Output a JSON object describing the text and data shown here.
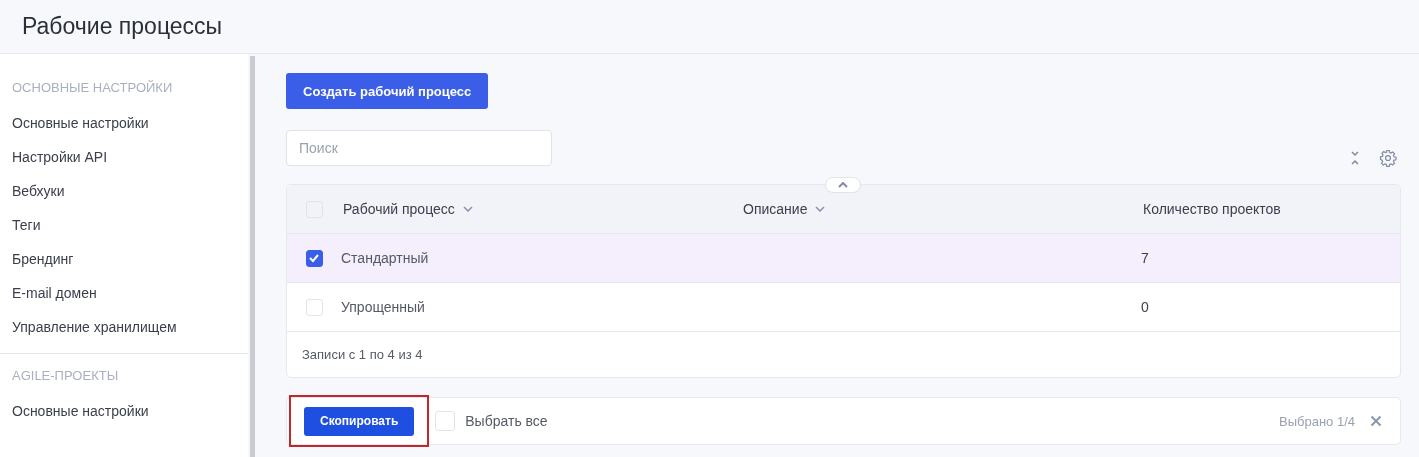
{
  "page_title": "Рабочие процессы",
  "sidebar": {
    "sections": [
      {
        "heading": "ОСНОВНЫЕ НАСТРОЙКИ",
        "items": [
          "Основные настройки",
          "Настройки API",
          "Вебхуки",
          "Теги",
          "Брендинг",
          "E-mail домен",
          "Управление хранилищем"
        ]
      },
      {
        "heading": "AGILE-ПРОЕКТЫ",
        "items": [
          "Основные настройки"
        ]
      }
    ]
  },
  "create_button": "Создать рабочий процесс",
  "search": {
    "placeholder": "Поиск"
  },
  "table": {
    "select_all_checked": false,
    "columns": [
      {
        "label": "Рабочий процесс",
        "sortable": true
      },
      {
        "label": "Описание",
        "sortable": true
      },
      {
        "label": "Количество проектов",
        "sortable": false
      }
    ],
    "rows": [
      {
        "name": "Стандартный",
        "description_col": "",
        "count": "7",
        "selected": true
      },
      {
        "name": "Упрощенный",
        "description_col": "",
        "count": "0",
        "selected": false
      }
    ],
    "footer": "Записи с 1 по 4 из 4"
  },
  "bulk_bar": {
    "copy_button": "Скопировать",
    "copy_highlighted": true,
    "select_all_label": "Выбрать все",
    "select_all_checked": false,
    "selected_count": "Выбрано 1/4"
  }
}
